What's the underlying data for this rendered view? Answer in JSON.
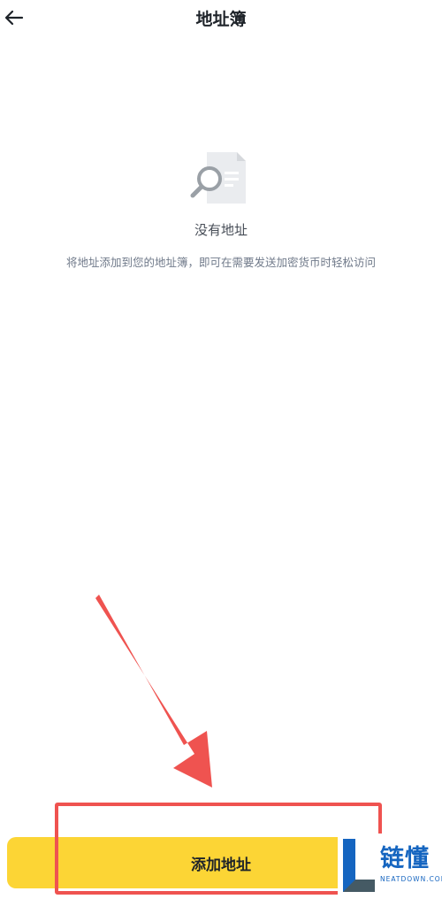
{
  "header": {
    "title": "地址簿",
    "back_icon": "arrow-left-icon"
  },
  "empty_state": {
    "icon": "document-search-icon",
    "title": "没有地址",
    "description": "将地址添加到您的地址簿，即可在需要发送加密货币时轻松访问"
  },
  "footer": {
    "add_button_label": "添加地址"
  },
  "annotation": {
    "highlight_color": "#ef5350",
    "arrow_color": "#ef5350"
  },
  "watermark": {
    "brand": "链懂",
    "sub": "NEATDOWN.COM"
  },
  "colors": {
    "accent": "#fcd535",
    "text_primary": "#1e2329",
    "text_secondary": "#707a8a"
  }
}
